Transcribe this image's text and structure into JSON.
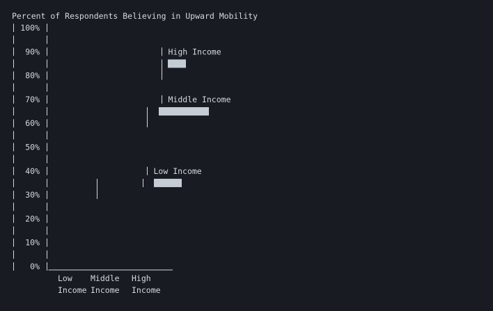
{
  "chart_data": {
    "type": "bar",
    "title": "Percent of Respondents Believing in Upward Mobility",
    "categories": [
      "Low Income",
      "Middle Income",
      "High Income"
    ],
    "category_label_lines": [
      [
        "Low",
        "Income"
      ],
      [
        "Middle",
        "Income"
      ],
      [
        "High",
        "Income"
      ]
    ],
    "values": [
      35,
      65,
      85
    ],
    "ylim": [
      0,
      100
    ],
    "yticks": [
      100,
      90,
      80,
      70,
      60,
      50,
      40,
      30,
      20,
      10,
      0
    ],
    "ytick_labels": [
      "100%",
      "90%",
      "80%",
      "70%",
      "60%",
      "50%",
      "40%",
      "30%",
      "20%",
      "10%",
      "0%"
    ],
    "annotations": [
      "Low Income",
      "Middle Income",
      "High Income"
    ],
    "xlabel": "",
    "ylabel": "",
    "grid": false,
    "colors": {
      "background": "#181c22",
      "text": "#d4d8dd",
      "bar": "#c5ccd4"
    }
  }
}
